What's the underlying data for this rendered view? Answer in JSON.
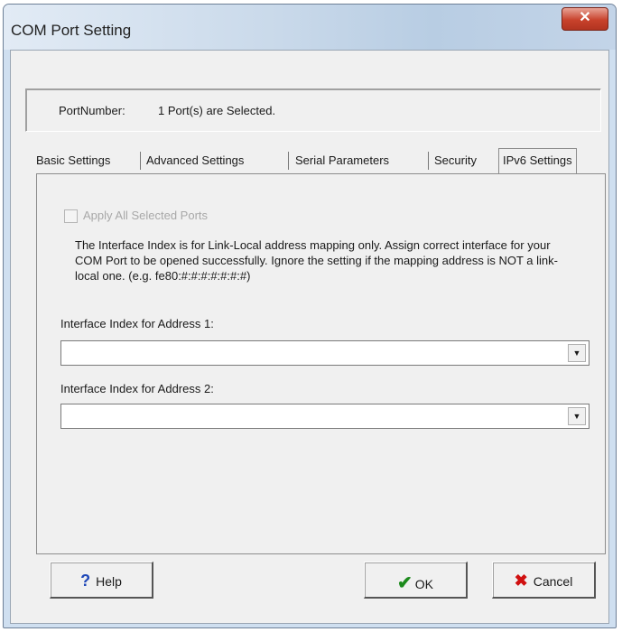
{
  "window": {
    "title": "COM Port Setting",
    "close_glyph": "✕"
  },
  "port": {
    "label": "PortNumber:",
    "value": "1 Port(s) are Selected."
  },
  "tabs": [
    {
      "label": "Basic Settings"
    },
    {
      "label": "Advanced Settings"
    },
    {
      "label": "Serial Parameters"
    },
    {
      "label": "Security"
    },
    {
      "label": "IPv6 Settings",
      "active": true
    }
  ],
  "ipv6": {
    "apply_all_label": "Apply All Selected Ports",
    "info_text": "The Interface Index is for Link-Local address mapping only. Assign correct interface for your COM Port to be opened successfully. Ignore the setting if the mapping address is NOT a link-local one. (e.g. fe80:#:#:#:#:#:#:#)",
    "addr1_label": "Interface Index for Address 1:",
    "addr1_value": "",
    "addr2_label": "Interface Index for Address 2:",
    "addr2_value": ""
  },
  "buttons": {
    "help": "Help",
    "ok": "OK",
    "cancel": "Cancel"
  },
  "icons": {
    "help": "question-mark-icon",
    "ok": "checkmark-icon",
    "cancel": "x-icon",
    "dropdown": "chevron-down-icon"
  }
}
